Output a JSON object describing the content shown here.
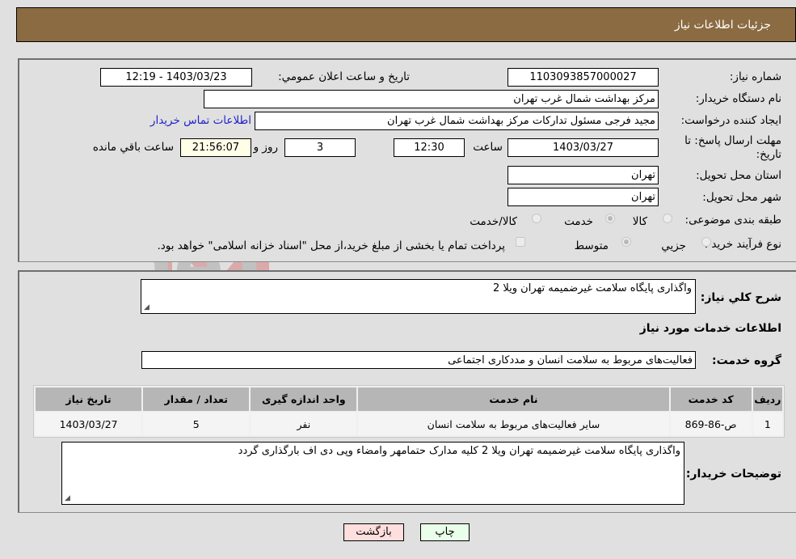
{
  "page_title": "جزئیات اطلاعات نیاز",
  "details": {
    "need_number_label": "شماره نیاز:",
    "need_number": "1103093857000027",
    "announce_label": "تاریخ و ساعت اعلان عمومي:",
    "announce_value": "1403/03/23 - 12:19",
    "buyer_org_label": "نام دستگاه خریدار:",
    "buyer_org": "مرکز بهداشت شمال غرب تهران",
    "creator_label": "ایجاد کننده درخواست:",
    "creator": "مجید فرجی مسئول تدارکات مرکز بهداشت شمال غرب تهران",
    "contact_link": "اطلاعات تماس خریدار",
    "deadline_label": "مهلت ارسال پاسخ: تا تاریخ:",
    "deadline_date": "1403/03/27",
    "time_label": "ساعت",
    "deadline_time": "12:30",
    "days_value": "3",
    "days_label": "روز و",
    "remaining_time": "21:56:07",
    "remaining_label": "ساعت باقي مانده",
    "province_label": "استان محل تحویل:",
    "province": "تهران",
    "city_label": "شهر محل تحویل:",
    "city": "تهران",
    "category_label": "طبقه بندی موضوعی:",
    "category_options": [
      "کالا",
      "خدمت",
      "کالا/خدمت"
    ],
    "category_selected": "خدمت",
    "process_label": "نوع فرآیند خرید :",
    "process_options": [
      "جزيي",
      "متوسط"
    ],
    "process_selected": "متوسط",
    "treasury_note": "پرداخت تمام یا بخشی از مبلغ خرید،از محل \"اسناد خزانه اسلامی\" خواهد بود."
  },
  "summary": {
    "general_desc_label": "شرح کلي نیاز:",
    "general_desc": "واگذاری پایگاه سلامت غیرضمیمه تهران ویلا 2",
    "services_heading": "اطلاعات خدمات مورد نیاز",
    "service_group_label": "گروه خدمت:",
    "service_group": "فعالیت‌های مربوط به سلامت انسان و مددکاری اجتماعی",
    "table": {
      "headers": [
        "ردیف",
        "کد خدمت",
        "نام خدمت",
        "واحد اندازه گیری",
        "تعداد / مقدار",
        "تاریخ نیاز"
      ],
      "rows": [
        [
          "1",
          "ص-86-869",
          "سایر فعالیت‌های مربوط به سلامت انسان",
          "نفر",
          "5",
          "1403/03/27"
        ]
      ]
    },
    "buyer_notes_label": "توضیحات خریدار:",
    "buyer_notes": "واگذاری پایگاه سلامت غیرضمیمه تهران ویلا 2 کلیه مدارک حتمامهر وامضاء وپی دی اف بارگذاری گردد"
  },
  "buttons": {
    "print": "چاپ",
    "back": "بازگشت"
  },
  "watermark_text": "AriaTender.neT",
  "colors": {
    "header_bg": "#8b6b42",
    "print_bg": "#eaffea",
    "back_bg": "#ffdede",
    "remaining_bg": "#ffffe8"
  }
}
